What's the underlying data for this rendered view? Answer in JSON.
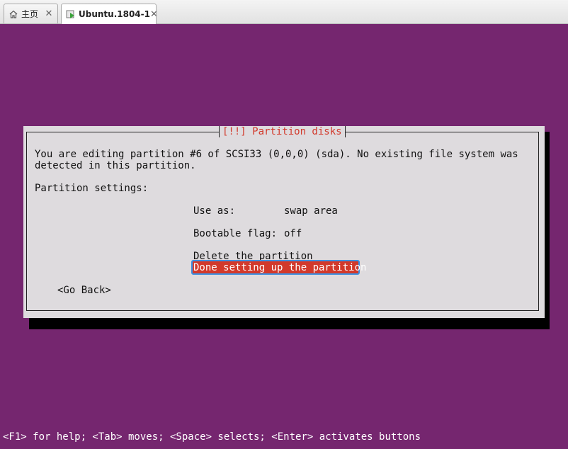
{
  "tabs": [
    {
      "label": "主页",
      "icon": "home-icon"
    },
    {
      "label": "Ubuntu.1804-1",
      "icon": "vm-play-icon"
    }
  ],
  "tab_close": "✕",
  "dialog": {
    "title": "[!!] Partition disks",
    "description_line1": "You are editing partition #6 of SCSI33 (0,0,0) (sda). No existing file system was",
    "description_line2": "detected in this partition.",
    "settings_heading": "Partition settings:",
    "use_as_label": "Use as:",
    "use_as_value": "swap area",
    "bootable_label": "Bootable flag:",
    "bootable_value": "off",
    "delete_option": "Delete the partition",
    "done_option": "Done setting up the partition",
    "go_back": "<Go Back>"
  },
  "footer_hint": "<F1> for help; <Tab> moves; <Space> selects; <Enter> activates buttons",
  "colors": {
    "desktop": "#75266f",
    "dialog": "#dedbde",
    "highlight": "#d2392b",
    "focus_ring": "#3d8fe0"
  }
}
